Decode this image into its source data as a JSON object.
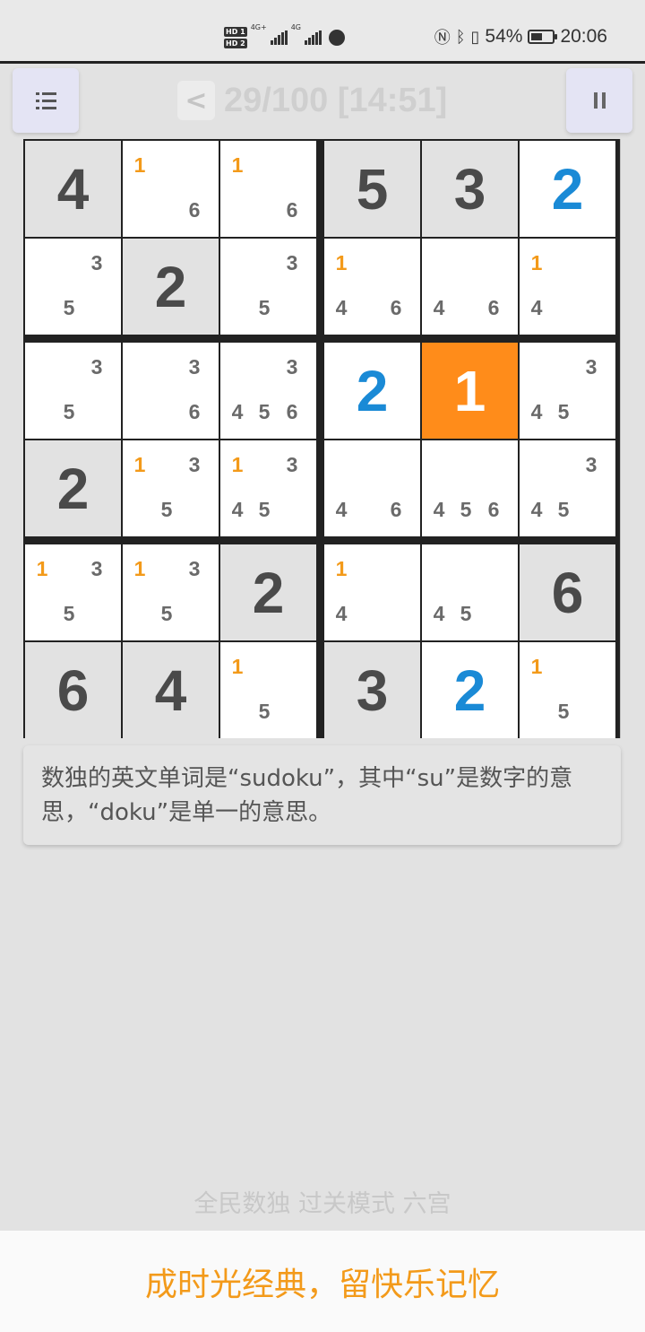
{
  "status_bar": {
    "hd1": "HD 1",
    "hd2": "HD 2",
    "net1": "4G+",
    "net2": "4G",
    "battery_percent": "54%",
    "time": "20:06",
    "battery_level": 0.54
  },
  "header": {
    "menu_icon": "list-menu-icon",
    "back_label": "<",
    "title": "29/100 [14:51]",
    "pause_icon": "pause-icon"
  },
  "board": {
    "size": 6,
    "cells": [
      [
        {
          "v": "4",
          "given": true
        },
        {
          "notes": [
            "1",
            "",
            "",
            "",
            "",
            "6"
          ]
        },
        {
          "notes": [
            "1",
            "",
            "",
            "",
            "",
            "6"
          ]
        },
        {
          "v": "5",
          "given": true
        },
        {
          "v": "3",
          "given": true
        },
        {
          "v": "2",
          "user": true
        }
      ],
      [
        {
          "notes": [
            "",
            "",
            "3",
            "",
            "5",
            ""
          ]
        },
        {
          "v": "2",
          "given": true
        },
        {
          "notes": [
            "",
            "",
            "3",
            "",
            "5",
            ""
          ]
        },
        {
          "notes": [
            "1",
            "",
            "",
            "4",
            "",
            "6"
          ]
        },
        {
          "notes": [
            "",
            "",
            "",
            "4",
            "",
            "6"
          ]
        },
        {
          "notes": [
            "1",
            "",
            "",
            "4",
            "",
            ""
          ]
        }
      ],
      [
        {
          "notes": [
            "",
            "",
            "3",
            "",
            "5",
            ""
          ]
        },
        {
          "notes": [
            "",
            "",
            "3",
            "",
            "",
            "6"
          ]
        },
        {
          "notes": [
            "",
            "",
            "3",
            "4",
            "5",
            "6"
          ]
        },
        {
          "v": "2",
          "user": true
        },
        {
          "v": "1",
          "user": true,
          "selected": true
        },
        {
          "notes": [
            "",
            "",
            "3",
            "4",
            "5",
            ""
          ]
        }
      ],
      [
        {
          "v": "2",
          "given": true
        },
        {
          "notes": [
            "1",
            "",
            "3",
            "",
            "5",
            ""
          ]
        },
        {
          "notes": [
            "1",
            "",
            "3",
            "4",
            "5",
            ""
          ]
        },
        {
          "notes": [
            "",
            "",
            "",
            "4",
            "",
            "6"
          ]
        },
        {
          "notes": [
            "",
            "",
            "",
            "4",
            "5",
            "6"
          ]
        },
        {
          "notes": [
            "",
            "",
            "3",
            "4",
            "5",
            ""
          ]
        }
      ],
      [
        {
          "notes": [
            "1",
            "",
            "3",
            "",
            "5",
            ""
          ]
        },
        {
          "notes": [
            "1",
            "",
            "3",
            "",
            "5",
            ""
          ]
        },
        {
          "v": "2",
          "given": true
        },
        {
          "notes": [
            "1",
            "",
            "",
            "4",
            "",
            ""
          ]
        },
        {
          "notes": [
            "",
            "",
            "",
            "4",
            "5",
            ""
          ]
        },
        {
          "v": "6",
          "given": true
        }
      ],
      [
        {
          "v": "6",
          "given": true
        },
        {
          "v": "4",
          "given": true
        },
        {
          "notes": [
            "1",
            "",
            "",
            "",
            "5",
            ""
          ]
        },
        {
          "v": "3",
          "given": true
        },
        {
          "v": "2",
          "user": true
        },
        {
          "notes": [
            "1",
            "",
            "",
            "",
            "5",
            ""
          ]
        }
      ]
    ]
  },
  "tip": "数独的英文单词是“sudoku”，其中“su”是数字的意思，“doku”是单一的意思。",
  "mode_label": "全民数独 过关模式 六宫",
  "footer_slogan": "成时光经典，留快乐记忆",
  "colors": {
    "selected_cell": "#ff8c1a",
    "user_digit": "#1a8ad6",
    "note_one": "#f39a1a",
    "slogan": "#f39a1a"
  }
}
